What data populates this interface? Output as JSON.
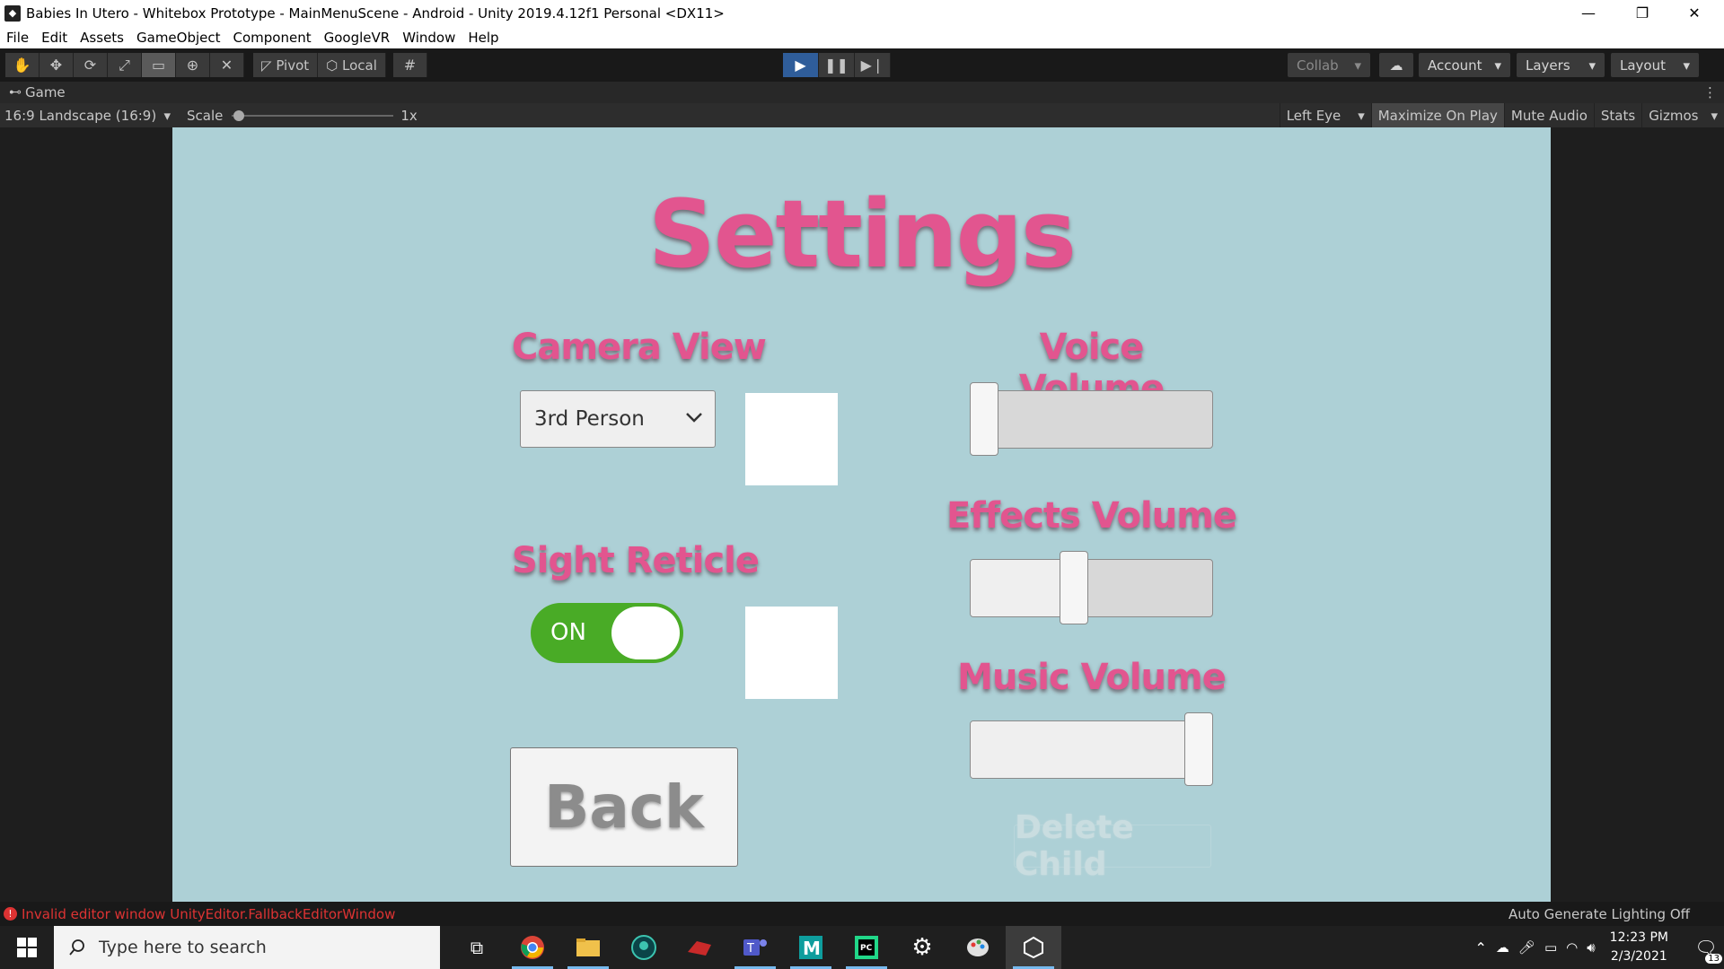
{
  "window": {
    "title": "Babies In Utero - Whitebox Prototype - MainMenuScene - Android - Unity 2019.4.12f1 Personal <DX11>",
    "controls": {
      "minimize": "—",
      "restore": "❐",
      "close": "✕"
    }
  },
  "menu": [
    "File",
    "Edit",
    "Assets",
    "GameObject",
    "Component",
    "GoogleVR",
    "Window",
    "Help"
  ],
  "toolbar": {
    "tools": [
      "hand-tool",
      "move-tool",
      "rotate-tool",
      "scale-tool",
      "rect-tool",
      "transform-tool",
      "custom-tool"
    ],
    "pivot_label": "Pivot",
    "local_label": "Local",
    "collab_label": "Collab",
    "account_label": "Account",
    "layers_label": "Layers",
    "layout_label": "Layout"
  },
  "game_tab": {
    "label": "Game",
    "aspect": "16:9 Landscape (16:9)",
    "scale_label": "Scale",
    "scale_value": "1x",
    "eye": "Left Eye",
    "maximize": "Maximize On Play",
    "mute": "Mute Audio",
    "stats": "Stats",
    "gizmos": "Gizmos"
  },
  "settings_screen": {
    "title": "Settings",
    "camera_view_label": "Camera View",
    "camera_view_value": "3rd Person",
    "sight_reticle_label": "Sight Reticle",
    "sight_reticle_state": "ON",
    "voice_volume_label": "Voice Volume",
    "voice_volume_level": 0.0,
    "effects_volume_label": "Effects Volume",
    "effects_volume_level": 0.42,
    "music_volume_label": "Music Volume",
    "music_volume_level": 1.0,
    "back_label": "Back",
    "delete_child_label": "Delete Child"
  },
  "status": {
    "error": "Invalid editor window UnityEditor.FallbackEditorWindow",
    "lighting": "Auto Generate Lighting Off"
  },
  "taskbar": {
    "search_placeholder": "Type here to search",
    "time": "12:23 PM",
    "date": "2/3/2021",
    "notification_count": "13"
  },
  "colors": {
    "canvas_bg": "#add0d6",
    "heading_pink": "#e2558f",
    "toggle_green": "#49ab26",
    "play_blue": "#2f5d9a",
    "error_red": "#d33"
  }
}
